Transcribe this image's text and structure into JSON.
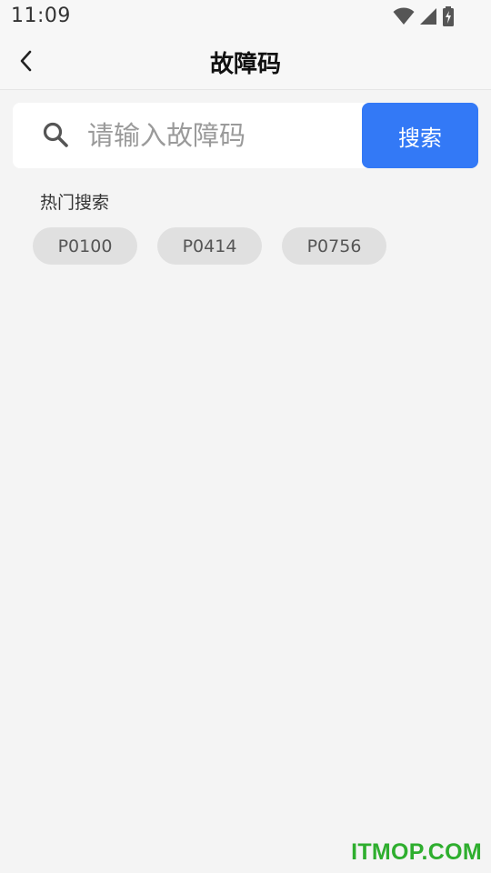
{
  "status_bar": {
    "time": "11:09",
    "icons": [
      "wifi-icon",
      "signal-icon",
      "battery-charging-icon"
    ]
  },
  "header": {
    "title": "故障码",
    "back_icon": "chevron-left-icon"
  },
  "search": {
    "placeholder": "请输入故障码",
    "value": "",
    "button_label": "搜索",
    "icon": "search-icon"
  },
  "hot_search": {
    "title": "热门搜索",
    "tags": [
      "P0100",
      "P0414",
      "P0756"
    ]
  },
  "watermark": "ITMOP.COM",
  "colors": {
    "accent": "#3379f6",
    "background": "#f4f4f4",
    "tag_background": "#e0e0e0",
    "watermark": "#2eae2e"
  }
}
